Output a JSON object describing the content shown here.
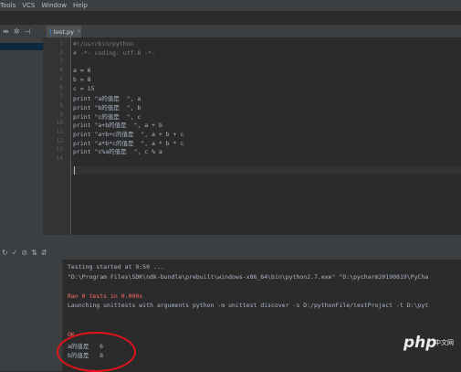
{
  "menu": {
    "items": [
      "Tools",
      "VCS",
      "Window",
      "Help"
    ]
  },
  "toolbar": {
    "icons": [
      "split-icon",
      "gear-icon",
      "hide-icon"
    ]
  },
  "tab": {
    "label": "test.py",
    "close": "×"
  },
  "editor": {
    "line_numbers": [
      "1",
      "2",
      "3",
      "4",
      "5",
      "6",
      "7",
      "8",
      "9",
      "10",
      "11",
      "12",
      "13",
      "14"
    ],
    "lines": [
      {
        "cls": "cmt",
        "text": "#!/usr/bin/python"
      },
      {
        "cls": "cmt",
        "text": "# -*- coding: utf-8 -*-"
      },
      {
        "cls": "",
        "text": ""
      },
      {
        "cls": "",
        "text": "a = 6"
      },
      {
        "cls": "",
        "text": "b = 8"
      },
      {
        "cls": "",
        "text": "c = 15"
      },
      {
        "cls": "",
        "text": "print \"a的值是  \", a"
      },
      {
        "cls": "",
        "text": "print \"b的值是  \", b"
      },
      {
        "cls": "",
        "text": "print \"c的值是  \", c"
      },
      {
        "cls": "",
        "text": "print \"a+b的值是  \", a + b"
      },
      {
        "cls": "",
        "text": "print \"a+b+c的值是  \", a + b + c"
      },
      {
        "cls": "",
        "text": "print \"a*b*c的值是  \", a * b * c"
      },
      {
        "cls": "",
        "text": "print \"c%a的值是  \", c % a"
      },
      {
        "cls": "",
        "text": ""
      }
    ]
  },
  "run": {
    "lines": [
      {
        "cls": "",
        "text": "Testing started at 9:50 ..."
      },
      {
        "cls": "",
        "text": "\"D:\\Program Files\\SDK\\ndk-bundle\\prebuilt\\windows-x86_64\\bin\\python2.7.exe\" \"D:\\pycharm20190819\\PyCha"
      },
      {
        "cls": "",
        "text": ""
      },
      {
        "cls": "err",
        "text": "Ran 0 tests in 0.000s"
      },
      {
        "cls": "",
        "text": "Launching unittests with arguments python -m unittest discover -s D:/pythonFile/testProject -t D:\\pyt"
      },
      {
        "cls": "",
        "text": ""
      },
      {
        "cls": "",
        "text": ""
      },
      {
        "cls": "err",
        "text": "OK"
      },
      {
        "cls": "",
        "text": "a的值是   6"
      },
      {
        "cls": "",
        "text": "b的值是   8"
      }
    ]
  },
  "watermark": {
    "text": "php",
    "color": "#e8e8e8"
  }
}
